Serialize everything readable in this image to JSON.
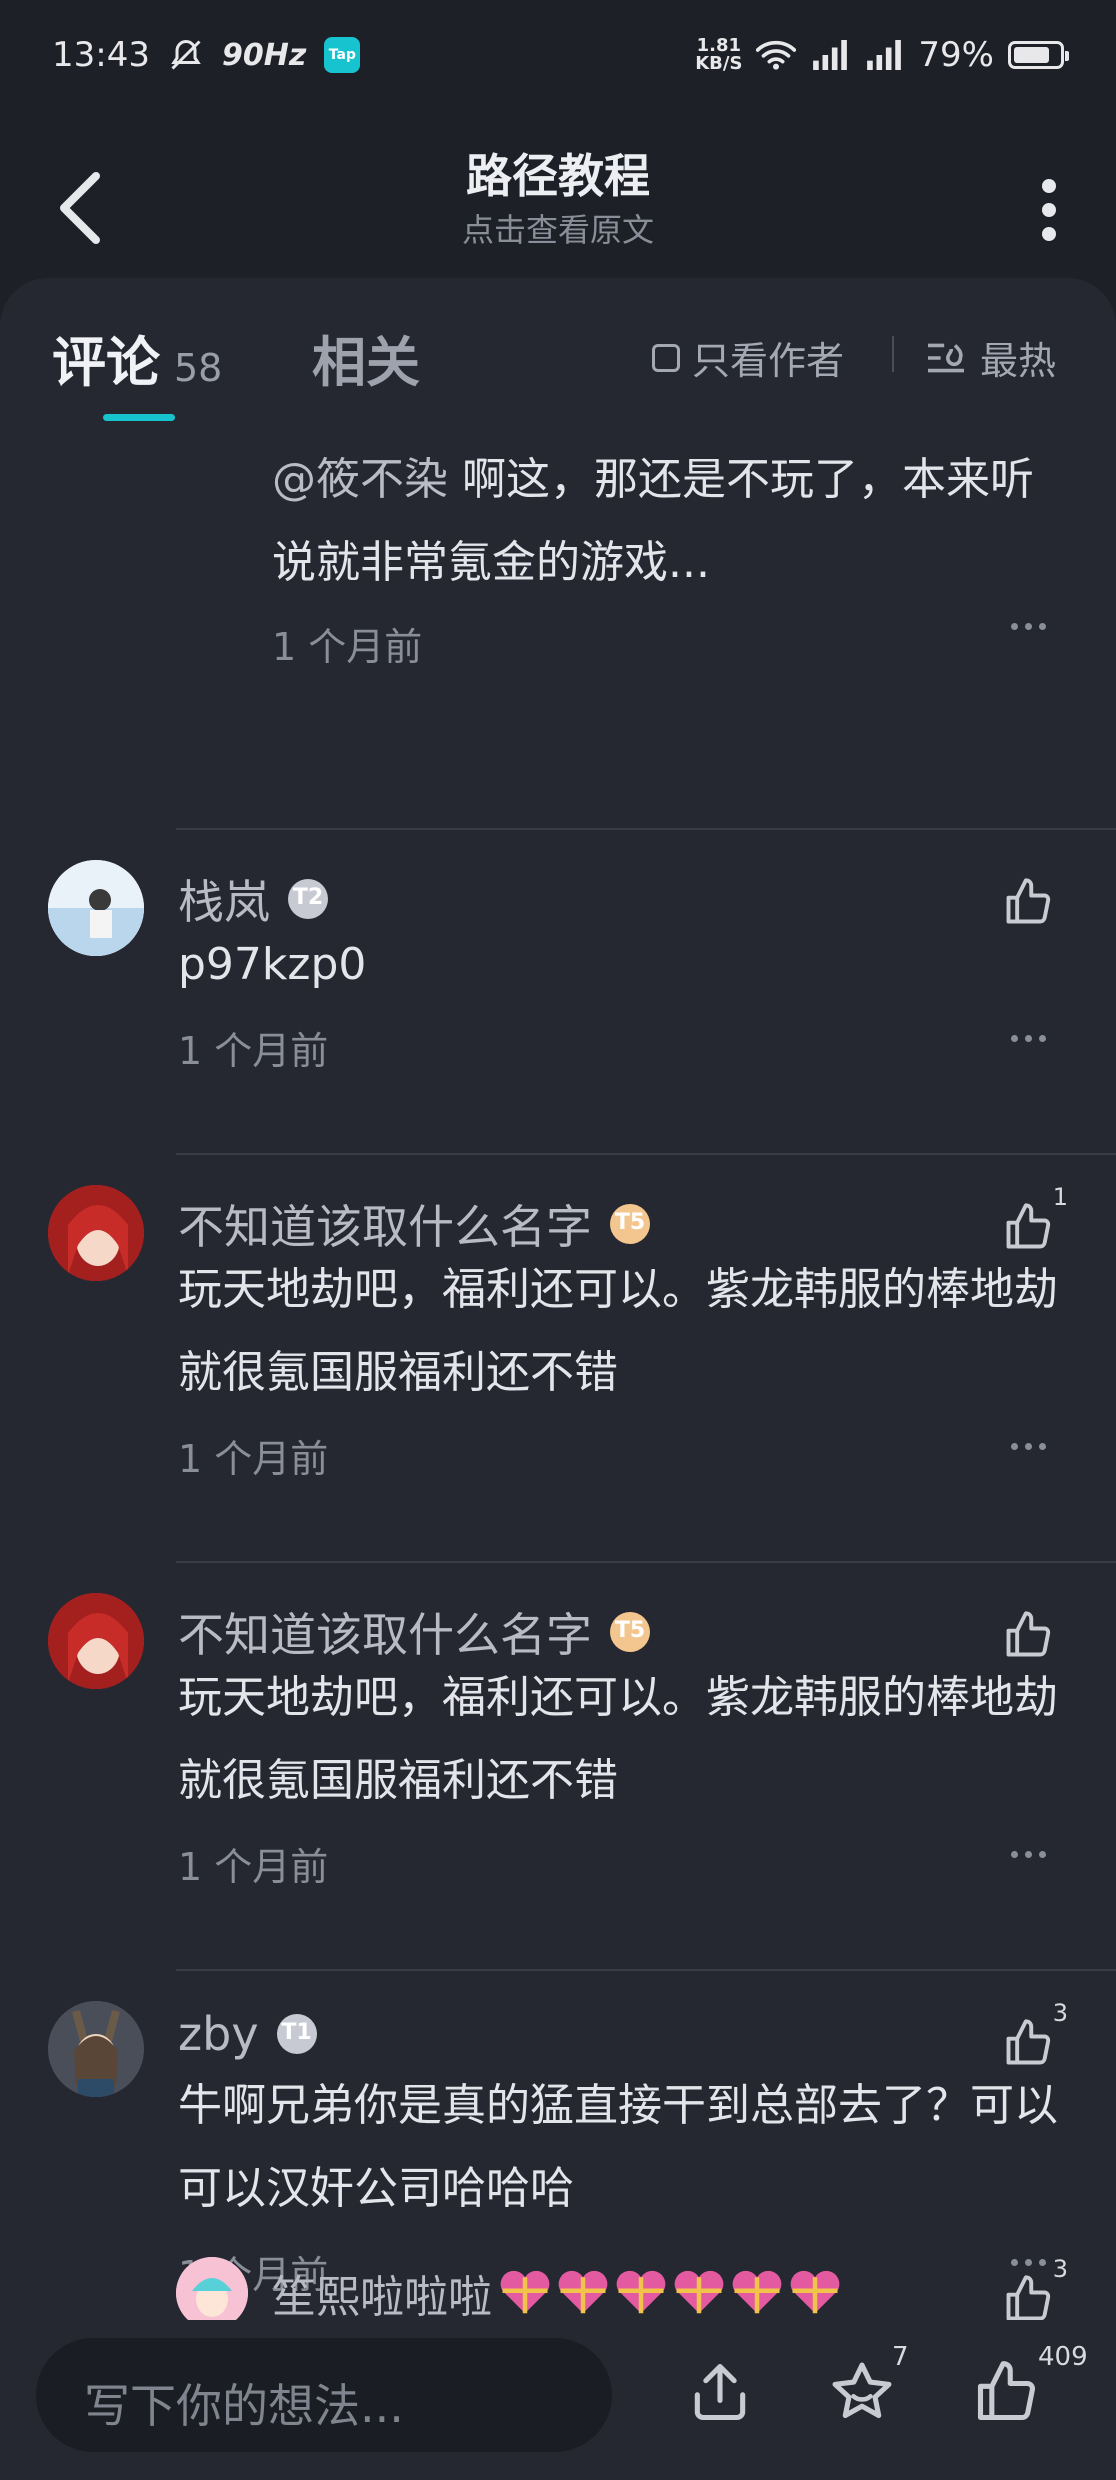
{
  "status_bar": {
    "time": "13:43",
    "refresh_rate": "90Hz",
    "app_badge": "Tap",
    "net_speed_value": "1.81",
    "net_speed_unit": "KB/S",
    "battery": "79%",
    "battery_level": 0.79
  },
  "header": {
    "title": "路径教程",
    "subtitle": "点击查看原文"
  },
  "tabs": {
    "comments_label": "评论",
    "comments_count": "58",
    "related_label": "相关",
    "author_only_label": "只看作者",
    "sort_label": "最热"
  },
  "reply_fragment": {
    "mention": "@筱不染",
    "text": " 啊这，那还是不玩了，本来听说就非常氪金的游戏...",
    "time": "1 个月前"
  },
  "comments": [
    {
      "username": "栈岚",
      "badge": "T2",
      "text": "p97kzp0",
      "time": "1 个月前",
      "likes": ""
    },
    {
      "username": "不知道该取什么名字",
      "badge": "T5",
      "text": "玩天地劫吧，福利还可以。紫龙韩服的棒地劫就很氪国服福利还不错",
      "time": "1 个月前",
      "likes": "1"
    },
    {
      "username": "不知道该取什么名字",
      "badge": "T5",
      "text": "玩天地劫吧，福利还可以。紫龙韩服的棒地劫就很氪国服福利还不错",
      "time": "1 个月前",
      "likes": ""
    },
    {
      "username": "zby",
      "badge": "T1",
      "text": "牛啊兄弟你是真的猛直接干到总部去了？可以可以汉奸公司哈哈哈",
      "time": "1 个月前",
      "likes": "3"
    }
  ],
  "sub_reply": {
    "username": "笙熙啦啦啦",
    "likes": "3"
  },
  "bottom_bar": {
    "compose_placeholder": "写下你的想法...",
    "favorite_count": "7",
    "like_count": "409"
  },
  "colors": {
    "background": "#1e2028",
    "panel": "#252731",
    "accent": "#17c3cf"
  }
}
